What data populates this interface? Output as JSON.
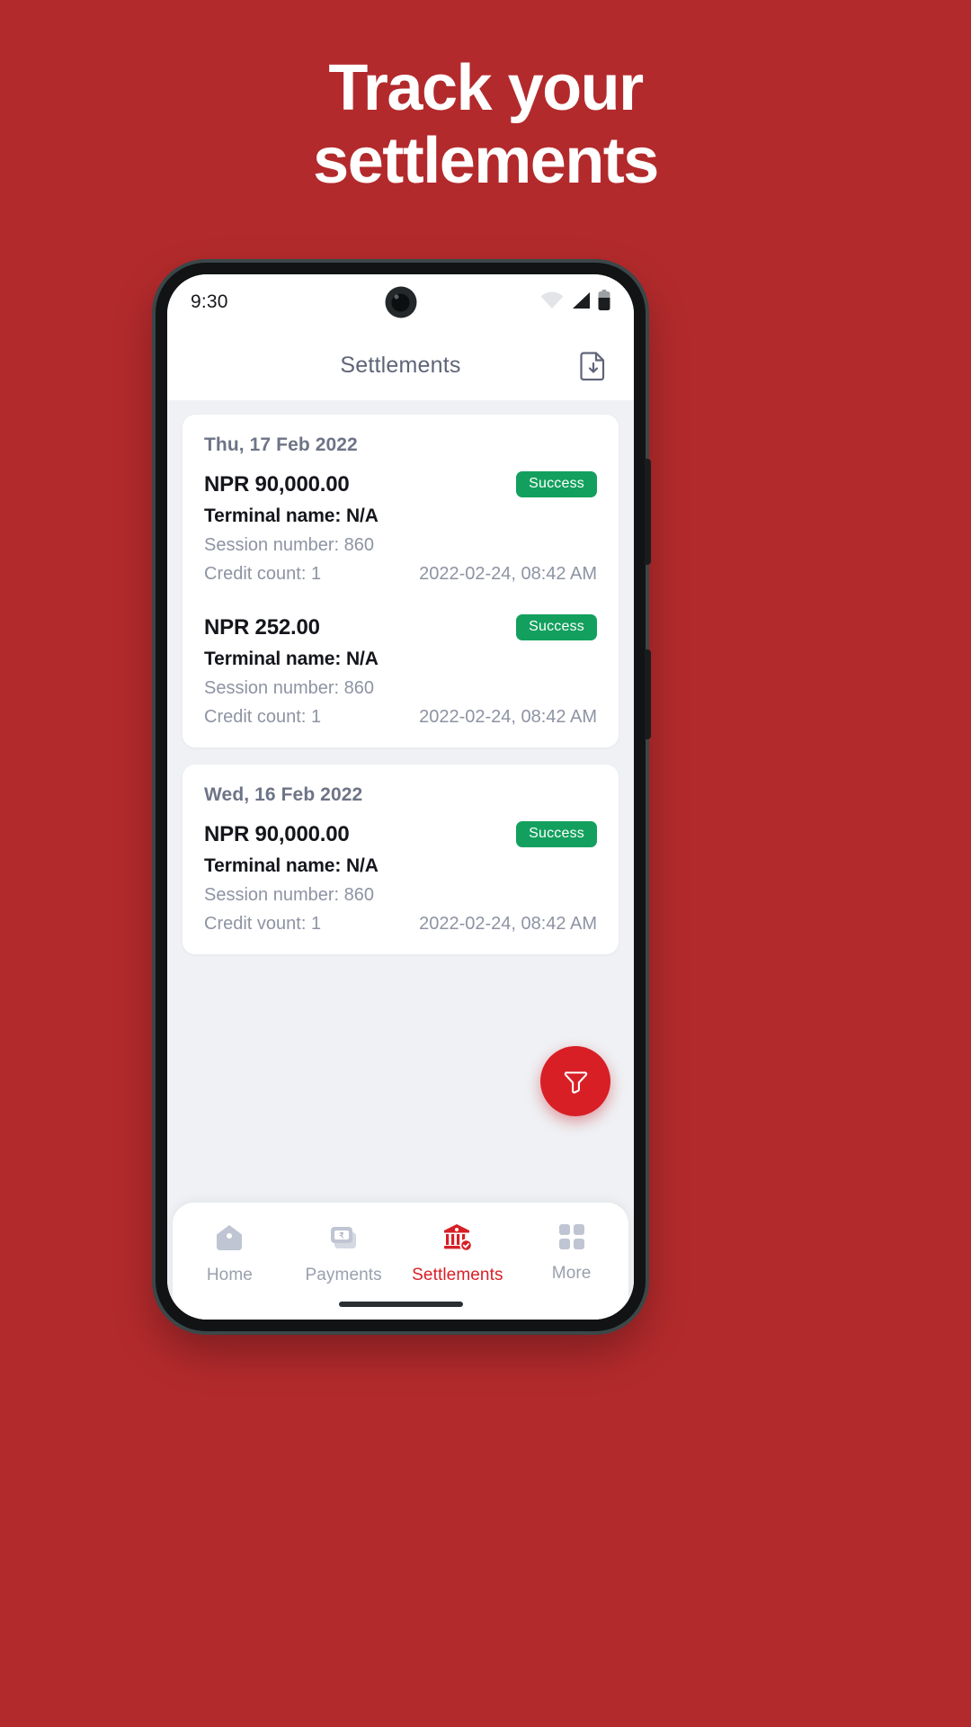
{
  "promo": {
    "heading": "Track your\nsettlements",
    "background_color": "#B32A2C",
    "text_color": "#FFFFFF"
  },
  "status_bar": {
    "time": "9:30",
    "icons": [
      "wifi-icon",
      "cellular-signal-icon",
      "battery-icon"
    ]
  },
  "header": {
    "title": "Settlements",
    "download_icon": "document-download-icon"
  },
  "cards": [
    {
      "date": "Thu, 17 Feb 2022",
      "entries": [
        {
          "amount": "NPR 90,000.00",
          "status": "Success",
          "terminal": "Terminal name: N/A",
          "session": "Session number: 860",
          "credit": "Credit count: 1",
          "timestamp": "2022-02-24, 08:42 AM"
        },
        {
          "amount": "NPR 252.00",
          "status": "Success",
          "terminal": "Terminal name: N/A",
          "session": "Session number: 860",
          "credit": "Credit count: 1",
          "timestamp": "2022-02-24, 08:42 AM"
        }
      ]
    },
    {
      "date": "Wed, 16 Feb 2022",
      "entries": [
        {
          "amount": "NPR 90,000.00",
          "status": "Success",
          "terminal": "Terminal name: N/A",
          "session": "Session number: 860",
          "credit": "Credit vount: 1",
          "timestamp": "2022-02-24, 08:42 AM"
        }
      ]
    }
  ],
  "fab": {
    "icon": "filter-funnel-icon",
    "color": "#D81F26"
  },
  "bottom_nav": {
    "active_color": "#D81F26",
    "inactive_color": "#9AA0AE",
    "items": [
      {
        "label": "Home",
        "icon": "home-icon",
        "active": false
      },
      {
        "label": "Payments",
        "icon": "banknote-icon",
        "active": false
      },
      {
        "label": "Settlements",
        "icon": "bank-check-icon",
        "active": true
      },
      {
        "label": "More",
        "icon": "grid-dots-icon",
        "active": false
      }
    ]
  },
  "status_colors": {
    "success_badge": "#13A05E"
  }
}
